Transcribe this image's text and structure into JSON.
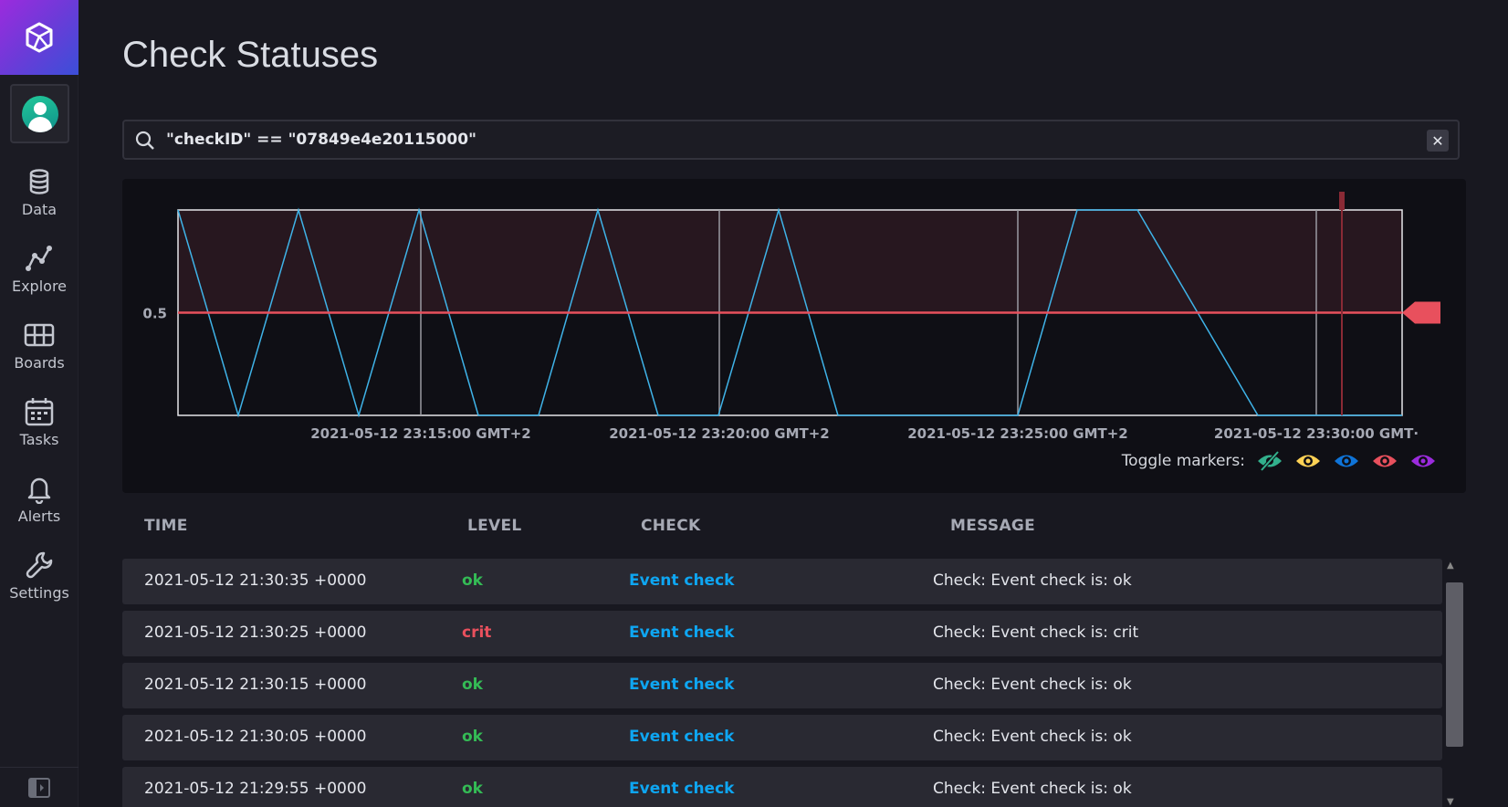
{
  "sidebar": {
    "items": [
      {
        "label": "Data",
        "icon": "database-icon"
      },
      {
        "label": "Explore",
        "icon": "graph-line-icon"
      },
      {
        "label": "Boards",
        "icon": "dashboard-grid-icon"
      },
      {
        "label": "Tasks",
        "icon": "calendar-icon"
      },
      {
        "label": "Alerts",
        "icon": "bell-icon"
      },
      {
        "label": "Settings",
        "icon": "wrench-icon"
      }
    ],
    "logo_icon": "influx-cube-icon",
    "avatar_icon": "user-avatar-icon",
    "collapse_icon": "sidebar-expand-icon"
  },
  "page": {
    "title": "Check Statuses"
  },
  "search": {
    "value": "\"checkID\" == \"07849e4e20115000\"",
    "clear_label": "✕"
  },
  "chart_data": {
    "type": "line",
    "x": [
      "23:11:00",
      "23:11:30",
      "23:11:40",
      "23:12:00",
      "23:12:10",
      "23:12:30",
      "23:12:40",
      "23:13:00",
      "23:13:20",
      "23:13:40",
      "23:14:00",
      "23:14:20",
      "23:14:40",
      "23:15:00",
      "23:15:20",
      "23:15:40",
      "23:16:00",
      "23:16:20",
      "23:16:40",
      "23:17:00",
      "23:17:20",
      "23:17:40",
      "23:18:00",
      "23:18:20",
      "23:18:40",
      "23:19:00",
      "23:19:20",
      "23:19:40",
      "23:20:00",
      "23:20:20",
      "23:20:40",
      "23:21:00",
      "23:21:20",
      "23:21:40",
      "23:22:00",
      "23:22:20",
      "23:22:40",
      "23:23:00"
    ],
    "series": [
      {
        "values": [
          1,
          0,
          1,
          0,
          1,
          0,
          0,
          1,
          0,
          0,
          1,
          0,
          0,
          0,
          0,
          1,
          1,
          0,
          0
        ]
      }
    ],
    "y_tick_labels": [
      "0.5"
    ],
    "x_tick_labels": [
      "2021-05-12 23:15:00 GMT+2",
      "2021-05-12 23:20:00 GMT+2",
      "2021-05-12 23:25:00 GMT+2",
      "2021-05-12 23:30:00 GMT·"
    ],
    "ylim": [
      0,
      1
    ],
    "threshold": {
      "value": 0.5,
      "color": "#e8505d"
    },
    "line_color": "#3fb3e8",
    "grid": true
  },
  "markers": {
    "label": "Toggle markers:",
    "items": [
      {
        "name": "ok-marker-toggle",
        "color": "#32b08c",
        "icon": "eye-slash-icon"
      },
      {
        "name": "info-marker-toggle",
        "color": "#ffd255",
        "icon": "eye-icon"
      },
      {
        "name": "warn-marker-toggle",
        "color": "#0f74d8",
        "icon": "eye-icon"
      },
      {
        "name": "crit-marker-toggle",
        "color": "#e8505d",
        "icon": "eye-icon"
      },
      {
        "name": "unknown-marker-toggle",
        "color": "#9b2bdd",
        "icon": "eye-icon"
      }
    ]
  },
  "table": {
    "headers": {
      "time": "TIME",
      "level": "LEVEL",
      "check": "CHECK",
      "message": "MESSAGE"
    },
    "rows": [
      {
        "time": "2021-05-12 21:30:35 +0000",
        "level": "ok",
        "check": "Event check",
        "message": "Check: Event check is: ok"
      },
      {
        "time": "2021-05-12 21:30:25 +0000",
        "level": "crit",
        "check": "Event check",
        "message": "Check: Event check is: crit"
      },
      {
        "time": "2021-05-12 21:30:15 +0000",
        "level": "ok",
        "check": "Event check",
        "message": "Check: Event check is: ok"
      },
      {
        "time": "2021-05-12 21:30:05 +0000",
        "level": "ok",
        "check": "Event check",
        "message": "Check: Event check is: ok"
      },
      {
        "time": "2021-05-12 21:29:55 +0000",
        "level": "ok",
        "check": "Event check",
        "message": "Check: Event check is: ok"
      }
    ]
  }
}
